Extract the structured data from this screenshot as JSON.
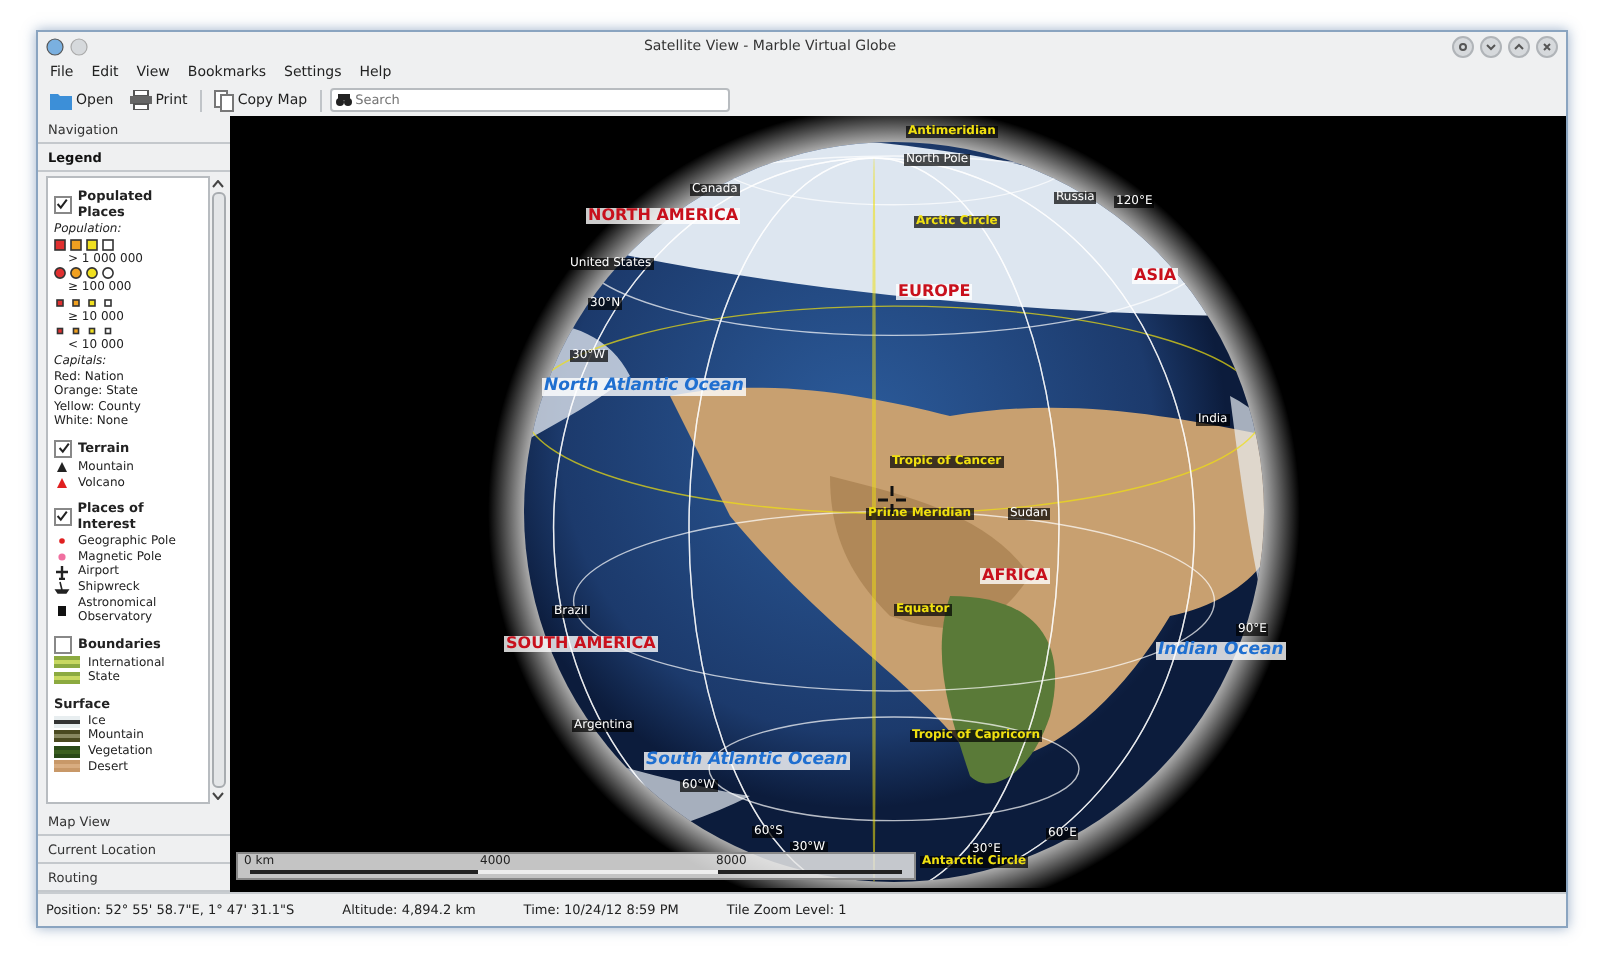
{
  "window": {
    "title": "Satellite View - Marble Virtual Globe"
  },
  "menu": [
    {
      "label": "File"
    },
    {
      "label": "Edit"
    },
    {
      "label": "View"
    },
    {
      "label": "Bookmarks"
    },
    {
      "label": "Settings"
    },
    {
      "label": "Help"
    }
  ],
  "toolbar": {
    "buttons": [
      {
        "label": "Open",
        "kind": "open"
      },
      {
        "label": "Print",
        "kind": "print"
      },
      {
        "label": "Copy Map",
        "kind": "copy"
      }
    ],
    "search": {
      "placeholder": "Search"
    }
  },
  "panel": {
    "tabs": [
      {
        "label": "Navigation",
        "selected": false
      },
      {
        "label": "Legend",
        "selected": true
      }
    ],
    "bottom_tabs": [
      {
        "label": "Map View",
        "selected": false
      },
      {
        "label": "Current Location",
        "selected": false
      },
      {
        "label": "Routing",
        "selected": false
      }
    ]
  },
  "legend": {
    "sections": [
      {
        "title": "Populated Places",
        "checked": true,
        "items": [
          {
            "kind": "caption",
            "text": "Population:"
          },
          {
            "kind": "symbols"
          },
          {
            "kind": "range",
            "text": "> 1 000 000"
          },
          {
            "kind": "symbols"
          },
          {
            "kind": "range",
            "text": "≥ 100 000"
          },
          {
            "kind": "symbols"
          },
          {
            "kind": "range",
            "text": "≥ 10 000"
          },
          {
            "kind": "symbols"
          },
          {
            "kind": "range",
            "text": "< 10 000"
          },
          {
            "kind": "caption",
            "text": "Capitals:"
          },
          {
            "kind": "text",
            "text": "Red: Nation"
          },
          {
            "kind": "text",
            "text": "Orange: State"
          },
          {
            "kind": "text",
            "text": "Yellow: County"
          },
          {
            "kind": "text",
            "text": "White: None"
          }
        ]
      },
      {
        "title": "Terrain",
        "checked": true,
        "items": [
          {
            "kind": "mountain",
            "text": "Mountain"
          },
          {
            "kind": "volcano",
            "text": "Volcano"
          }
        ]
      },
      {
        "title": "Places of Interest",
        "checked": true,
        "items": [
          {
            "kind": "pole",
            "text": "Geographic Pole"
          },
          {
            "kind": "magnetic",
            "text": "Magnetic Pole"
          },
          {
            "kind": "airport",
            "text": "Airport"
          },
          {
            "kind": "shipwreck",
            "text": "Shipwreck"
          },
          {
            "kind": "observatory",
            "text": "Astronomical Observatory"
          }
        ]
      },
      {
        "title": "Boundaries",
        "checked": false,
        "items": [
          {
            "kind": "border",
            "text": "International"
          },
          {
            "kind": "border",
            "text": "State"
          }
        ]
      },
      {
        "title": "Surface",
        "items": [
          {
            "kind": "ice",
            "text": "Ice"
          },
          {
            "kind": "rock",
            "text": "Mountain"
          },
          {
            "kind": "vegetation",
            "text": "Vegetation"
          },
          {
            "kind": "desert",
            "text": "Desert"
          }
        ]
      }
    ]
  },
  "map": {
    "labels": [
      {
        "text": "Antimeridian",
        "kind": "line"
      },
      {
        "text": "North Pole",
        "kind": "country"
      },
      {
        "text": "Canada",
        "kind": "country"
      },
      {
        "text": "Russia",
        "kind": "country"
      },
      {
        "text": "120°E",
        "kind": "grid"
      },
      {
        "text": "NORTH AMERICA",
        "kind": "continent"
      },
      {
        "text": "Arctic Circle",
        "kind": "line"
      },
      {
        "text": "United States",
        "kind": "country"
      },
      {
        "text": "ASIA",
        "kind": "continent"
      },
      {
        "text": "EUROPE",
        "kind": "continent"
      },
      {
        "text": "30°N",
        "kind": "grid"
      },
      {
        "text": "30°W",
        "kind": "grid"
      },
      {
        "text": "North Atlantic Ocean",
        "kind": "ocean"
      },
      {
        "text": "India",
        "kind": "country"
      },
      {
        "text": "Tropic of Cancer",
        "kind": "line"
      },
      {
        "text": "Prime Meridian",
        "kind": "line"
      },
      {
        "text": "Sudan",
        "kind": "country"
      },
      {
        "text": "AFRICA",
        "kind": "continent"
      },
      {
        "text": "Equator",
        "kind": "line"
      },
      {
        "text": "Brazil",
        "kind": "country"
      },
      {
        "text": "90°E",
        "kind": "grid"
      },
      {
        "text": "SOUTH AMERICA",
        "kind": "continent"
      },
      {
        "text": "Indian Ocean",
        "kind": "ocean"
      },
      {
        "text": "Argentina",
        "kind": "country"
      },
      {
        "text": "Tropic of Capricorn",
        "kind": "line"
      },
      {
        "text": "South Atlantic Ocean",
        "kind": "ocean"
      },
      {
        "text": "60°W",
        "kind": "grid"
      },
      {
        "text": "60°S",
        "kind": "grid"
      },
      {
        "text": "60°E",
        "kind": "grid"
      },
      {
        "text": "30°W",
        "kind": "grid"
      },
      {
        "text": "30°E",
        "kind": "grid"
      },
      {
        "text": "Antarctic Circle",
        "kind": "line"
      }
    ],
    "scale": [
      "0 km",
      "4000",
      "8000"
    ]
  },
  "status_bar": [
    "Position: 52° 55' 58.7\"E,  1° 47' 31.1\"S",
    "Altitude: 4,894.2 km",
    "Time: 10/24/12 8:59 PM",
    "Tile Zoom Level: 1"
  ]
}
